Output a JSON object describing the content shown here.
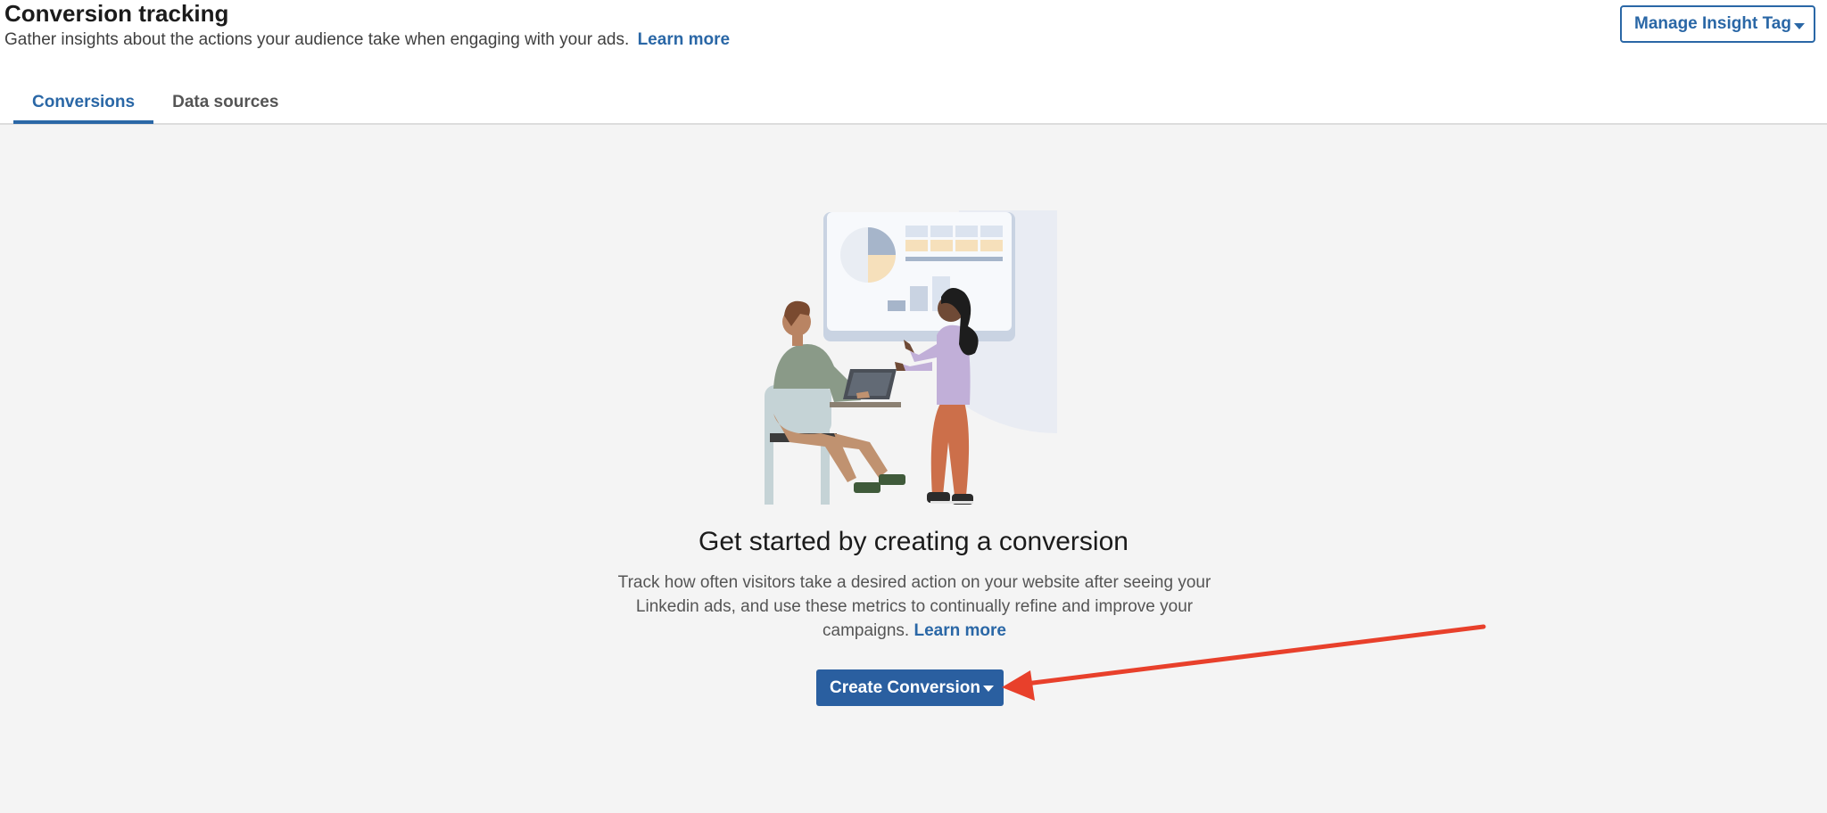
{
  "header": {
    "title": "Conversion tracking",
    "subtitle": "Gather insights about the actions your audience take when engaging with your ads.",
    "learn_more": "Learn more",
    "manage_button": "Manage Insight Tag"
  },
  "tabs": [
    {
      "label": "Conversions",
      "active": true
    },
    {
      "label": "Data sources",
      "active": false
    }
  ],
  "empty_state": {
    "title": "Get started by creating a conversion",
    "description": "Track how often visitors take a desired action on your website after seeing your Linkedin ads, and use these metrics to continually refine and improve your campaigns.",
    "learn_more": "Learn more",
    "create_button": "Create Conversion"
  },
  "colors": {
    "accent": "#2a67a6",
    "primary_button": "#2a5fa0",
    "annotation_arrow": "#e8402b",
    "content_bg": "#f4f4f4"
  }
}
